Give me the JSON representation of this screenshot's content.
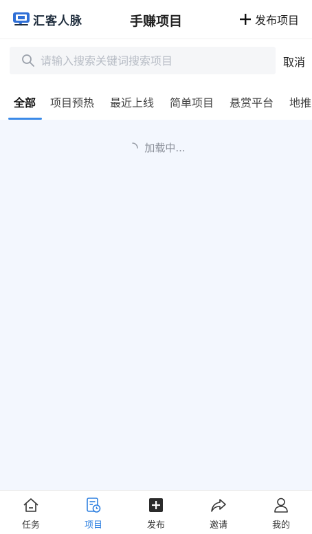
{
  "header": {
    "logo_text": "汇客人脉",
    "title": "手赚项目",
    "publish_label": "发布项目"
  },
  "search": {
    "placeholder": "请输入搜索关键词搜索项目",
    "value": "",
    "cancel_label": "取消"
  },
  "tabs": [
    {
      "label": "全部",
      "active": true
    },
    {
      "label": "项目预热",
      "active": false
    },
    {
      "label": "最近上线",
      "active": false
    },
    {
      "label": "简单项目",
      "active": false
    },
    {
      "label": "悬赏平台",
      "active": false
    },
    {
      "label": "地推",
      "active": false
    }
  ],
  "loading": {
    "text": "加载中..."
  },
  "bottom_nav": [
    {
      "label": "任务",
      "icon": "home-icon",
      "active": false
    },
    {
      "label": "项目",
      "icon": "project-icon",
      "active": true
    },
    {
      "label": "发布",
      "icon": "publish-icon",
      "active": false
    },
    {
      "label": "邀请",
      "icon": "share-icon",
      "active": false
    },
    {
      "label": "我的",
      "icon": "user-icon",
      "active": false
    }
  ],
  "colors": {
    "accent": "#2f80e0",
    "content_background": "#f3f7fe",
    "logo": "#2f6fd6"
  }
}
